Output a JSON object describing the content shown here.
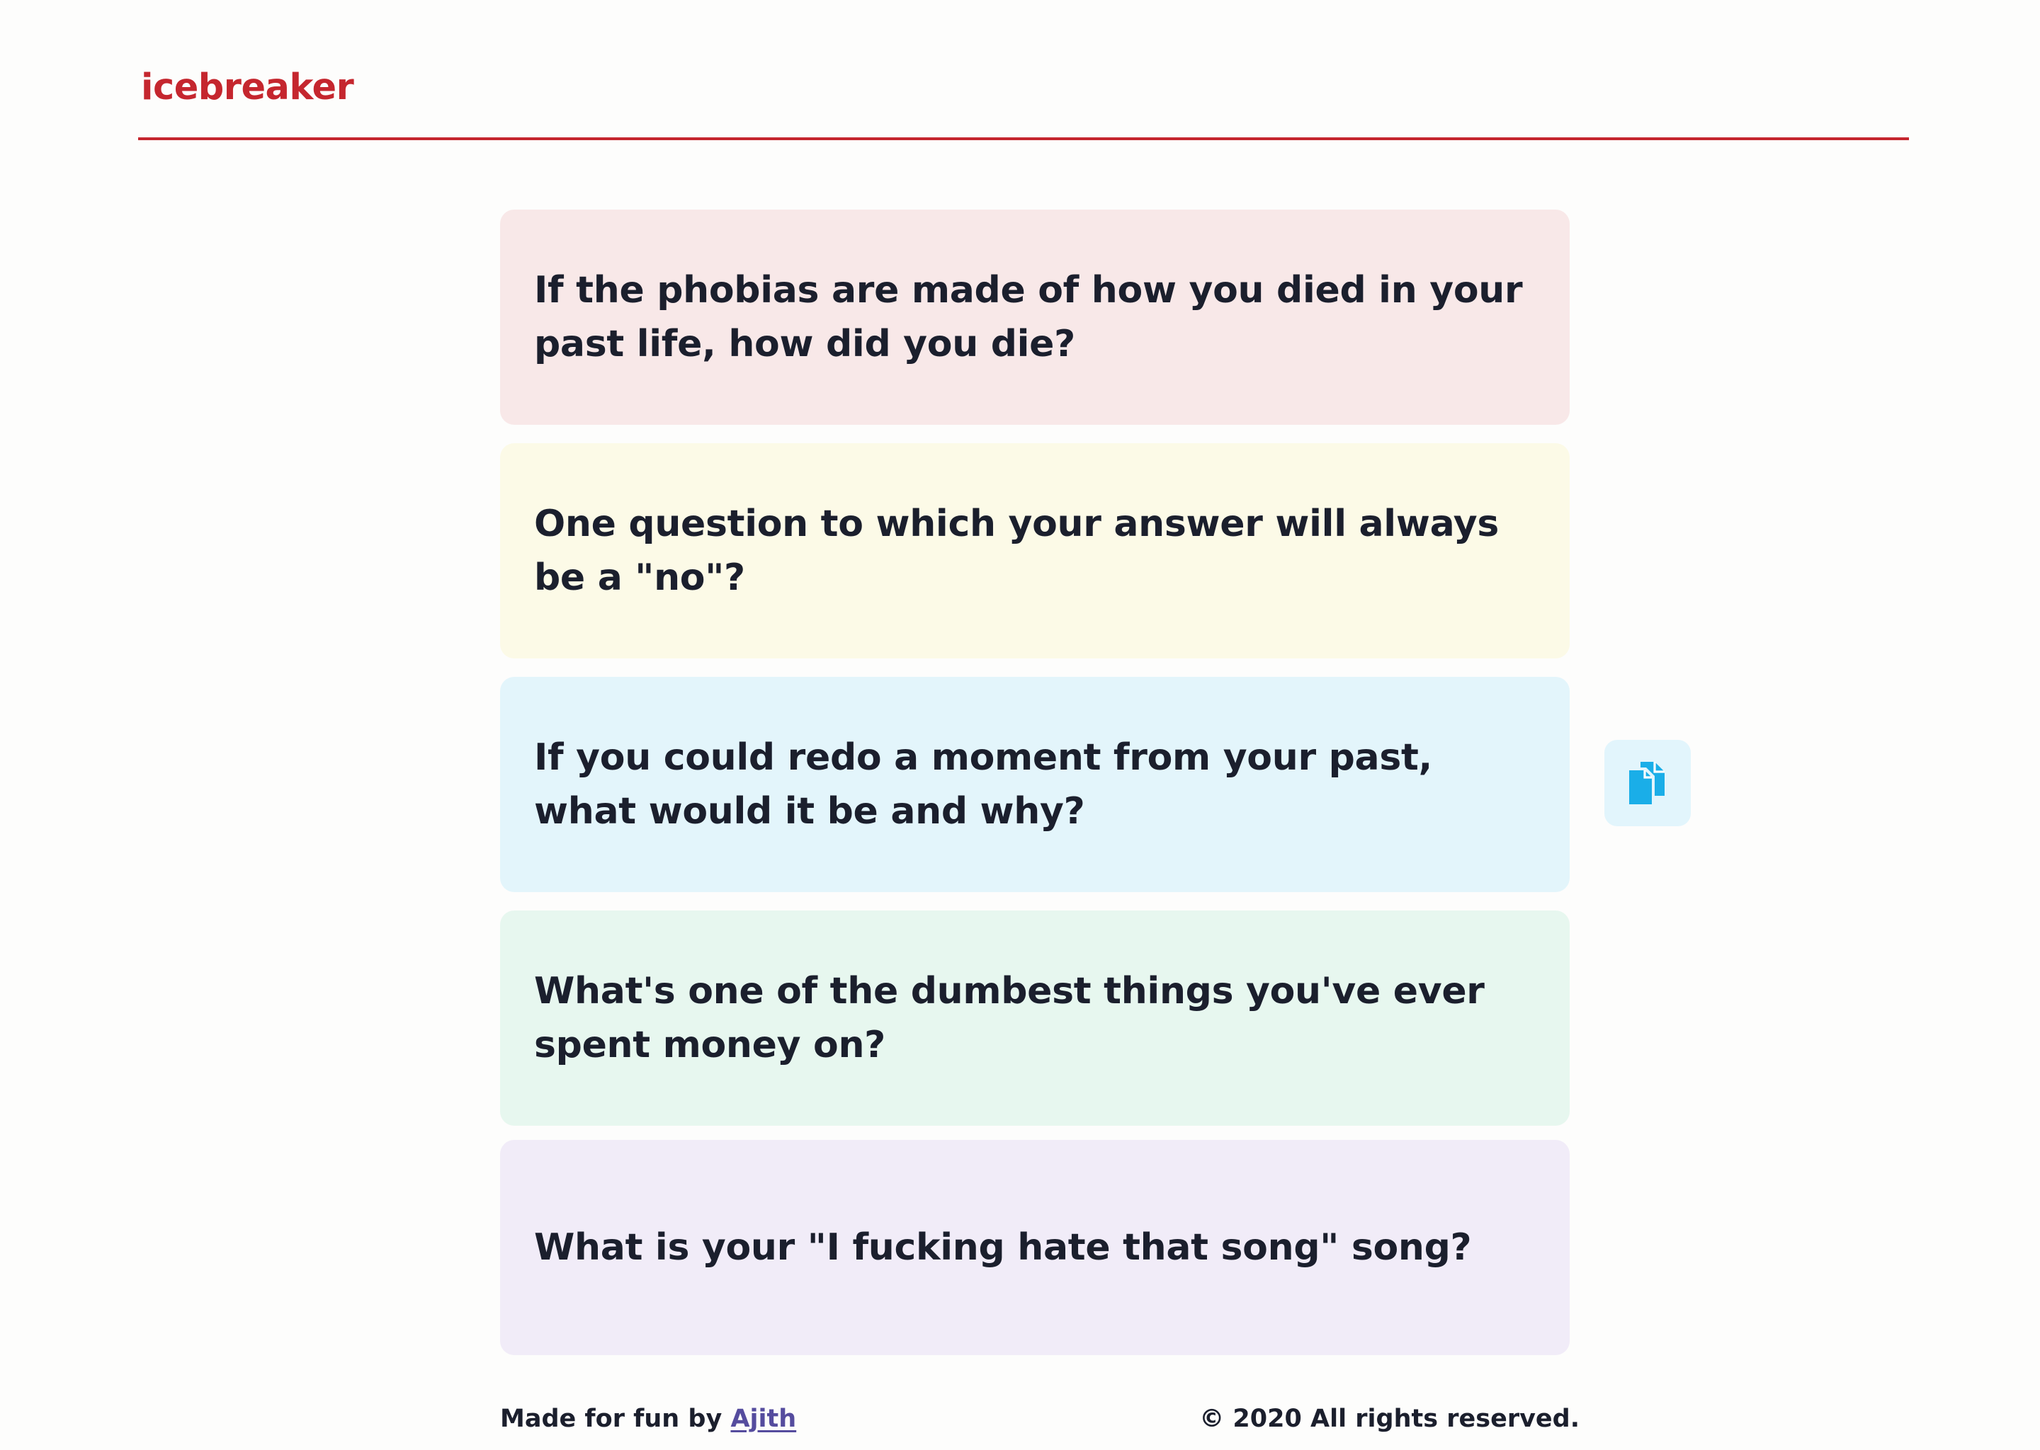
{
  "header": {
    "logo_text": "icebreaker"
  },
  "questions": [
    {
      "text": "If the phobias are made of how you died in your past life, how did you die?",
      "background": "#f8e8e8"
    },
    {
      "text": "One question to which your answer will always be a \"no\"?",
      "background": "#fcfae7"
    },
    {
      "text": "If you could redo a moment from your past, what would it be and why?",
      "background": "#e3f5fb"
    },
    {
      "text": "What's one of the dumbest things you've ever spent money on?",
      "background": "#e7f7ef"
    },
    {
      "text": "What is your \"I fucking hate that song\" song?",
      "background": "#f1ecf8"
    }
  ],
  "copy_button": {
    "icon": "copy-icon",
    "icon_color": "#1aaee8",
    "background": "#e2f5fc"
  },
  "footer": {
    "credit_prefix": "Made for fun by ",
    "author_name": "Ajith",
    "copyright": "© 2020 All rights reserved."
  },
  "colors": {
    "accent": "#c5262e",
    "text": "#1b1f2d",
    "link": "#554c9e"
  }
}
